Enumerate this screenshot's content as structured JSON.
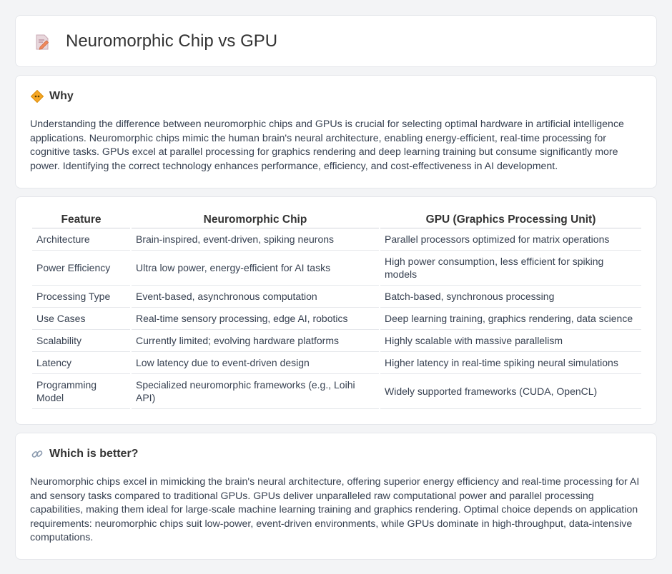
{
  "header": {
    "title": "Neuromorphic Chip vs GPU",
    "icon": "document-pencil-icon"
  },
  "why": {
    "title": "Why",
    "icon": "diamond-sign-icon",
    "text": "Understanding the difference between neuromorphic chips and GPUs is crucial for selecting optimal hardware in artificial intelligence applications. Neuromorphic chips mimic the human brain's neural architecture, enabling energy-efficient, real-time processing for cognitive tasks. GPUs excel at parallel processing for graphics rendering and deep learning training but consume significantly more power. Identifying the correct technology enhances performance, efficiency, and cost-effectiveness in AI development."
  },
  "table": {
    "headers": [
      "Feature",
      "Neuromorphic Chip",
      "GPU (Graphics Processing Unit)"
    ],
    "rows": [
      [
        "Architecture",
        "Brain-inspired, event-driven, spiking neurons",
        "Parallel processors optimized for matrix operations"
      ],
      [
        "Power Efficiency",
        "Ultra low power, energy-efficient for AI tasks",
        "High power consumption, less efficient for spiking models"
      ],
      [
        "Processing Type",
        "Event-based, asynchronous computation",
        "Batch-based, synchronous processing"
      ],
      [
        "Use Cases",
        "Real-time sensory processing, edge AI, robotics",
        "Deep learning training, graphics rendering, data science"
      ],
      [
        "Scalability",
        "Currently limited; evolving hardware platforms",
        "Highly scalable with massive parallelism"
      ],
      [
        "Latency",
        "Low latency due to event-driven design",
        "Higher latency in real-time spiking neural simulations"
      ],
      [
        "Programming Model",
        "Specialized neuromorphic frameworks (e.g., Loihi API)",
        "Widely supported frameworks (CUDA, OpenCL)"
      ]
    ]
  },
  "better": {
    "title": "Which is better?",
    "icon": "link-icon",
    "text": "Neuromorphic chips excel in mimicking the brain's neural architecture, offering superior energy efficiency and real-time processing for AI and sensory tasks compared to traditional GPUs. GPUs deliver unparalleled raw computational power and parallel processing capabilities, making them ideal for large-scale machine learning training and graphics rendering. Optimal choice depends on application requirements: neuromorphic chips suit low-power, event-driven environments, while GPUs dominate in high-throughput, data-intensive computations."
  }
}
